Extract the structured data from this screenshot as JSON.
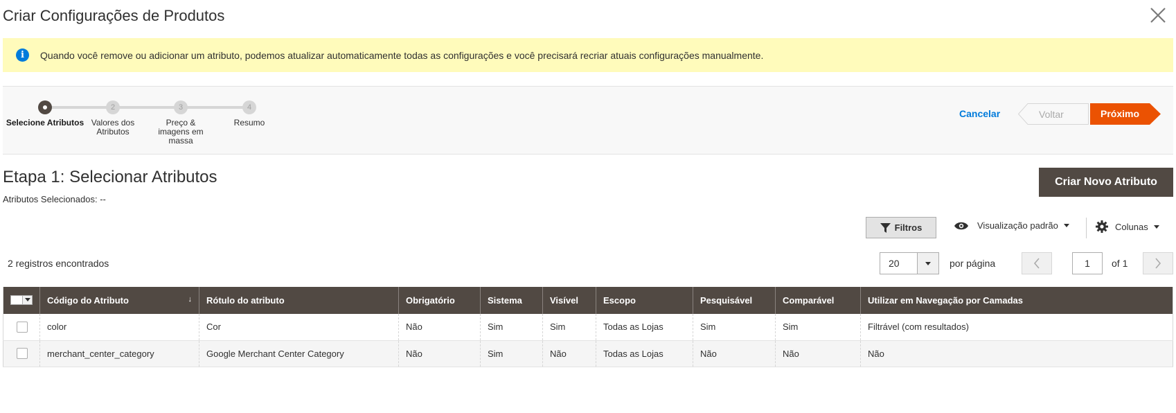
{
  "modal": {
    "title": "Criar Configurações de Produtos"
  },
  "notice": {
    "text": "Quando você remove ou adicionar um atributo, podemos atualizar automaticamente todas as configurações e você precisará recriar atuais configurações manualmente."
  },
  "wizard": {
    "steps": [
      {
        "number": "",
        "label": "Selecione Atributos",
        "active": true
      },
      {
        "number": "2",
        "label": "Valores dos Atributos",
        "active": false
      },
      {
        "number": "3",
        "label": "Preço & imagens em massa",
        "active": false
      },
      {
        "number": "4",
        "label": "Resumo",
        "active": false
      }
    ],
    "cancel_label": "Cancelar",
    "back_label": "Voltar",
    "next_label": "Próximo"
  },
  "step": {
    "title": "Etapa 1: Selecionar Atributos",
    "selected_info": "Atributos Selecionados: --",
    "create_button": "Criar Novo Atributo"
  },
  "toolbar": {
    "filters_label": "Filtros",
    "view_label": "Visualização padrão",
    "columns_label": "Colunas",
    "records_found": "2 registros encontrados",
    "per_page_value": "20",
    "per_page_label": "por página",
    "page_value": "1",
    "page_of": "of 1"
  },
  "table": {
    "columns": [
      "Código do Atributo",
      "Rótulo do atributo",
      "Obrigatório",
      "Sistema",
      "Visível",
      "Escopo",
      "Pesquisável",
      "Comparável",
      "Utilizar em Navegação por Camadas"
    ],
    "sort_indicator": "↓",
    "rows": [
      [
        "color",
        "Cor",
        "Não",
        "Sim",
        "Sim",
        "Todas as Lojas",
        "Sim",
        "Sim",
        "Filtrável (com resultados)"
      ],
      [
        "merchant_center_category",
        "Google Merchant Center Category",
        "Não",
        "Sim",
        "Não",
        "Todas as Lojas",
        "Não",
        "Não",
        "Não"
      ]
    ]
  },
  "colors": {
    "accent_orange": "#eb5202",
    "header_dark": "#514943",
    "link_blue": "#007bdb",
    "notice_yellow": "#fffbbb"
  }
}
